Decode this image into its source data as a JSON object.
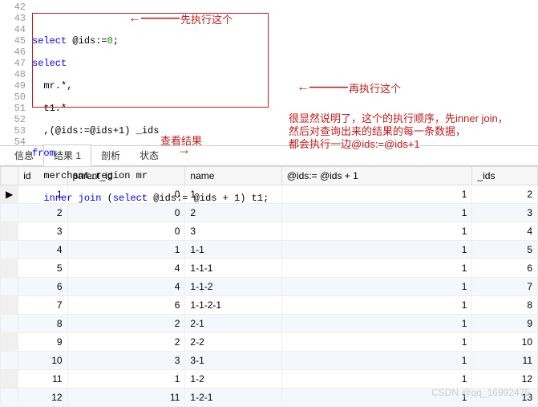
{
  "gutter": [
    "42",
    "43",
    "44",
    "45",
    "46",
    "47",
    "48",
    "49",
    "50",
    "51",
    "52",
    "53",
    "54"
  ],
  "code": {
    "l43a": "select",
    "l43b": " @ids:=",
    "l43c": "0",
    "l43d": ";",
    "l44": "select",
    "l45": "  mr.*,",
    "l46": "  t1.*",
    "l47": "  ,(@ids:=@ids+1) _ids",
    "l48": "from",
    "l49": "  merchant_region mr",
    "l50a": "  ",
    "l50b": "inner",
    "l50c": " ",
    "l50d": "join",
    "l50e": " (",
    "l50f": "select",
    "l50g": " @ids:= @ids + 1) t1;"
  },
  "annos": {
    "a1": "先执行这个",
    "a2": "再执行这个",
    "a3": "很显然说明了，这个的执行顺序，先inner join，\n然后对查询出来的结果的每一条数据，\n都会执行一边@ids:=@ids+1",
    "a4": "查看结果",
    "arL1": "←———",
    "arL2": "←———"
  },
  "tabs": {
    "t1": "信息",
    "t2": "结果 1",
    "t3": "剖析",
    "t4": "状态"
  },
  "cols": {
    "c1": "id",
    "c2": "parent_id",
    "c3": "name",
    "c4": "@ids:= @ids + 1",
    "c5": "_ids"
  },
  "rows": [
    {
      "id": "1",
      "parent_id": "0",
      "name": "1",
      "e": "1",
      "ids": "2"
    },
    {
      "id": "2",
      "parent_id": "0",
      "name": "2",
      "e": "1",
      "ids": "3"
    },
    {
      "id": "3",
      "parent_id": "0",
      "name": "3",
      "e": "1",
      "ids": "4"
    },
    {
      "id": "4",
      "parent_id": "1",
      "name": "1-1",
      "e": "1",
      "ids": "5"
    },
    {
      "id": "5",
      "parent_id": "4",
      "name": "1-1-1",
      "e": "1",
      "ids": "6"
    },
    {
      "id": "6",
      "parent_id": "4",
      "name": "1-1-2",
      "e": "1",
      "ids": "7"
    },
    {
      "id": "7",
      "parent_id": "6",
      "name": "1-1-2-1",
      "e": "1",
      "ids": "8"
    },
    {
      "id": "8",
      "parent_id": "2",
      "name": "2-1",
      "e": "1",
      "ids": "9"
    },
    {
      "id": "9",
      "parent_id": "2",
      "name": "2-2",
      "e": "1",
      "ids": "10"
    },
    {
      "id": "10",
      "parent_id": "3",
      "name": "3-1",
      "e": "1",
      "ids": "11"
    },
    {
      "id": "11",
      "parent_id": "1",
      "name": "1-2",
      "e": "1",
      "ids": "12"
    },
    {
      "id": "12",
      "parent_id": "11",
      "name": "1-2-1",
      "e": "1",
      "ids": "13"
    }
  ],
  "watermark": "CSDN @qq_16992475"
}
